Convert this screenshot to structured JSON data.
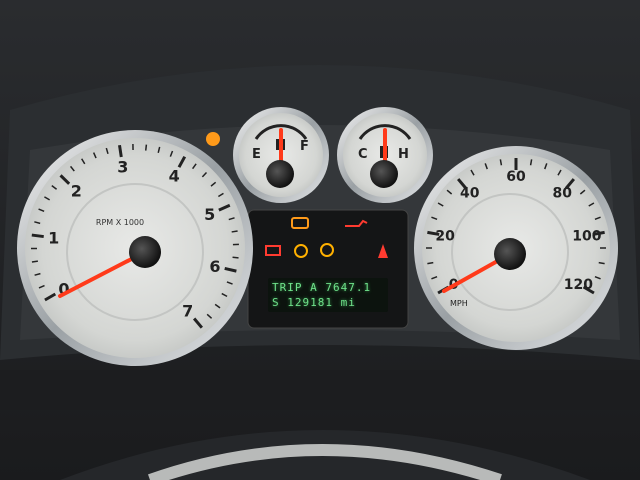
{
  "cluster": {
    "tachometer": {
      "unit_label": "RPM X 1000",
      "tick_labels": [
        "0",
        "1",
        "2",
        "3",
        "4",
        "5",
        "6",
        "7"
      ],
      "needle_value_krpm": 0
    },
    "fuel_gauge": {
      "empty_label": "E",
      "full_label": "F",
      "level_fraction": 0.08
    },
    "temp_gauge": {
      "cold_label": "C",
      "hot_label": "H",
      "level_fraction": 0.1
    },
    "speedometer": {
      "unit_label": "MPH",
      "tick_labels": [
        "0",
        "20",
        "40",
        "60",
        "80",
        "100",
        "120"
      ],
      "needle_value_mph": 0
    },
    "info_display": {
      "line1": "TRIP A  7647.1",
      "line2": "S    129181 mi"
    },
    "warning_lights": [
      {
        "name": "check-engine",
        "color": "#ff9a1a"
      },
      {
        "name": "oil-pressure",
        "color": "#ff3b30"
      },
      {
        "name": "battery",
        "color": "#ff3b30"
      },
      {
        "name": "tpms",
        "color": "#ffb000"
      },
      {
        "name": "airbag",
        "color": "#ff3b30"
      },
      {
        "name": "seatbelt",
        "color": "#ff3b30"
      },
      {
        "name": "fuel-pump",
        "color": "#ffa500"
      }
    ]
  },
  "colors": {
    "needle": "#ff3a1a",
    "face": "#d8dad8",
    "bezel": "#c9ccce",
    "lcd": "#6fe08a"
  }
}
